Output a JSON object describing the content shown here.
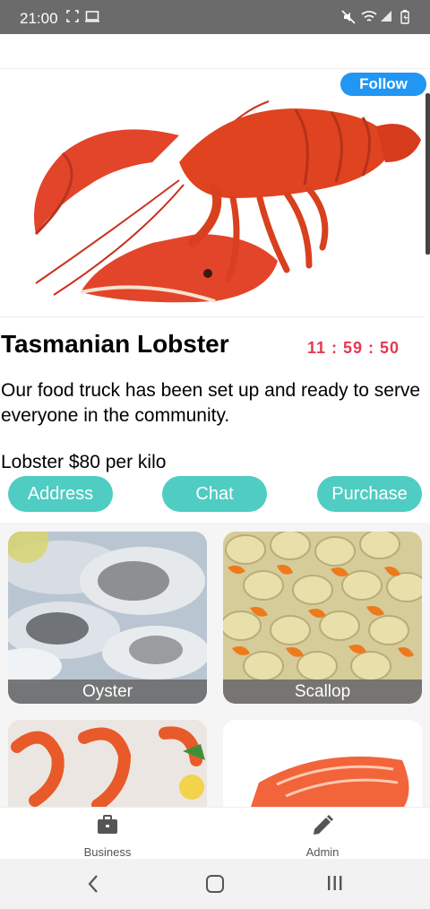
{
  "status_bar": {
    "time": "21:00",
    "icons": [
      "screenshot-icon",
      "cast-icon",
      "mute-icon",
      "wifi-icon",
      "signal-icon",
      "battery-icon"
    ]
  },
  "header": {
    "follow_label": "Follow"
  },
  "product": {
    "title": "Tasmanian Lobster",
    "timer": "11 : 59 : 50",
    "description": "Our food truck has been set up and ready to serve everyone in the community.",
    "price": "Lobster $80 per kilo"
  },
  "actions": {
    "address_label": "Address",
    "chat_label": "Chat",
    "purchase_label": "Purchase"
  },
  "items": [
    {
      "label": "Oyster"
    },
    {
      "label": "Scallop"
    },
    {
      "label": ""
    },
    {
      "label": ""
    }
  ],
  "bottom_nav": {
    "business_label": "Business",
    "admin_label": "Admin"
  },
  "colors": {
    "accent": "#4fcdc3",
    "follow": "#2196f3",
    "timer": "#e53950",
    "status_bar": "#6b6b6b"
  }
}
